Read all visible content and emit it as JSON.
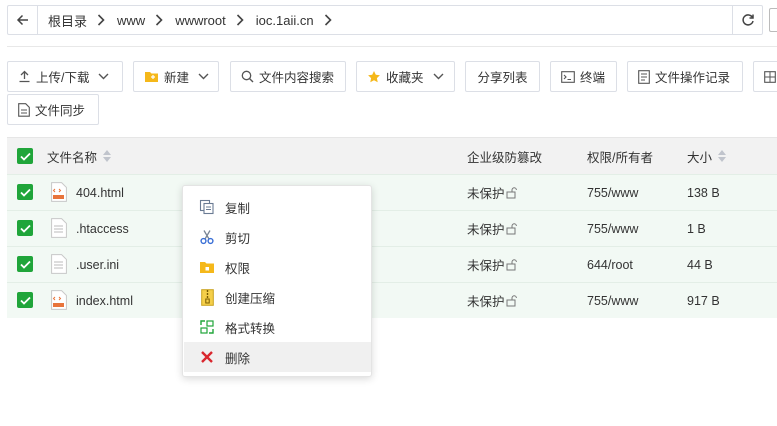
{
  "breadcrumb": [
    "根目录",
    "www",
    "wwwroot",
    "ioc.1aii.cn"
  ],
  "toolbar": {
    "upload": "上传/下载",
    "new": "新建",
    "search": "文件内容搜索",
    "favorites": "收藏夹",
    "share_list": "分享列表",
    "terminal": "终端",
    "op_log": "文件操作记录",
    "sync": "文件同步"
  },
  "table": {
    "headers": {
      "name": "文件名称",
      "tamper": "企业级防篡改",
      "perm": "权限/所有者",
      "size": "大小"
    },
    "rows": [
      {
        "name": "404.html",
        "type": "html",
        "tamper": "未保护",
        "perm": "755/www",
        "size": "138 B"
      },
      {
        "name": ".htaccess",
        "type": "text",
        "tamper": "未保护",
        "perm": "755/www",
        "size": "1 B"
      },
      {
        "name": ".user.ini",
        "type": "text",
        "tamper": "未保护",
        "perm": "644/root",
        "size": "44 B"
      },
      {
        "name": "index.html",
        "type": "html",
        "tamper": "未保护",
        "perm": "755/www",
        "size": "917 B"
      }
    ]
  },
  "context_menu": {
    "items": [
      "复制",
      "剪切",
      "权限",
      "创建压缩",
      "格式转换",
      "删除"
    ]
  },
  "colors": {
    "accent": "#20a53a",
    "danger": "#d9272e",
    "folder": "#f5b81a"
  }
}
